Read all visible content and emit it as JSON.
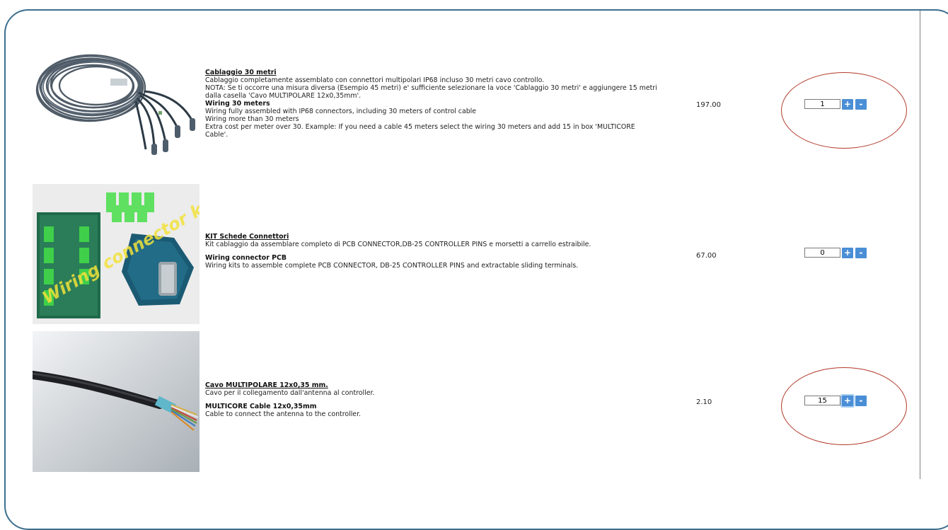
{
  "products": [
    {
      "image_icon": "coiled-cable-photo",
      "title_it": "Cablaggio 30 metri",
      "desc_it": "Cablaggio completamente assemblato con connettori multipolari IP68 incluso 30 metri cavo controllo.",
      "note_it": "NOTA: Se ti occorre una misura diversa (Esempio 45 metri) e' sufficiente selezionare la voce 'Cablaggio 30 metri' e aggiungere 15 metri dalla casella 'Cavo MULTIPOLARE 12x0,35mm'.",
      "title_en": "Wiring 30 meters",
      "desc_en_1": "Wiring fully assembled with IP68 connectors, including 30 meters of control cable",
      "desc_en_2": "Wiring more than 30 meters",
      "desc_en_3": "Extra cost per meter over 30. Example: If you need a cable 45 meters select the wiring 30 meters and add 15 in box 'MULTICORE Cable'.",
      "price": "197.00",
      "qty": "1",
      "plus": "+",
      "minus": "-"
    },
    {
      "image_icon": "wiring-connector-kit-photo",
      "image_caption": "Wiring connector kit",
      "title_it": "KIT Schede Connettori",
      "desc_it": "Kit cablaggio da assemblare completo di PCB CONNECTOR,DB-25 CONTROLLER PINS e morsetti a carrello estraibile.",
      "title_en": "Wiring connector PCB",
      "desc_en": "Wiring kits to assemble complete PCB CONNECTOR, DB-25 CONTROLLER PINS and extractable sliding terminals.",
      "price": "67.00",
      "qty": "0",
      "plus": "+",
      "minus": "-"
    },
    {
      "image_icon": "multicore-cable-photo",
      "title_it": "Cavo MULTIPOLARE 12x0,35 mm.",
      "desc_it": "Cavo per il collegamento dall'antenna al controller.",
      "title_en": "MULTICORE Cable 12x0,35mm",
      "desc_en": "Cable to connect the antenna to the controller.",
      "price": "2.10",
      "qty": "15",
      "plus": "+",
      "minus": "-"
    }
  ],
  "colors": {
    "frame": "#3c6f8f",
    "annotation_ellipse": "#b23a2a",
    "button": "#4a8ed6"
  }
}
